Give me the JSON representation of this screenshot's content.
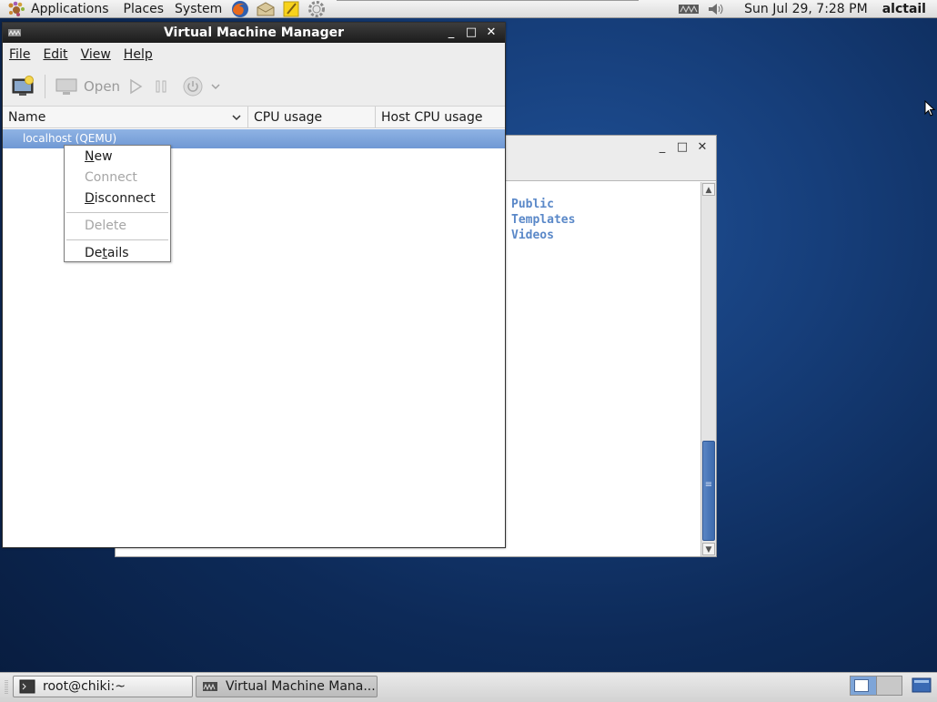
{
  "top_panel": {
    "menus": [
      "Applications",
      "Places",
      "System"
    ],
    "clock": "Sun Jul 29,  7:28 PM",
    "user": "alctail"
  },
  "vmm": {
    "title": "Virtual Machine Manager",
    "menubar": [
      "File",
      "Edit",
      "View",
      "Help"
    ],
    "toolbar": {
      "open_label": "Open"
    },
    "columns": [
      "Name",
      "CPU usage",
      "Host CPU usage"
    ],
    "connection": "localhost (QEMU)"
  },
  "context_menu": {
    "items": [
      {
        "label": "New",
        "enabled": true
      },
      {
        "label": "Connect",
        "enabled": false
      },
      {
        "label": "Disconnect",
        "enabled": true
      },
      {
        "label": "Delete",
        "enabled": false
      },
      {
        "label": "Details",
        "enabled": true
      }
    ]
  },
  "background_window": {
    "files": [
      "Public",
      "Templates",
      "Videos"
    ]
  },
  "taskbar": {
    "items": [
      {
        "label": "root@chiki:~",
        "icon": "terminal-icon"
      },
      {
        "label": "Virtual Machine Mana...",
        "icon": "vmm-icon"
      }
    ]
  },
  "colors": {
    "selection": "#7fa6dc",
    "desktop": "#163e7a",
    "titlebar": "#2a2a2a"
  }
}
